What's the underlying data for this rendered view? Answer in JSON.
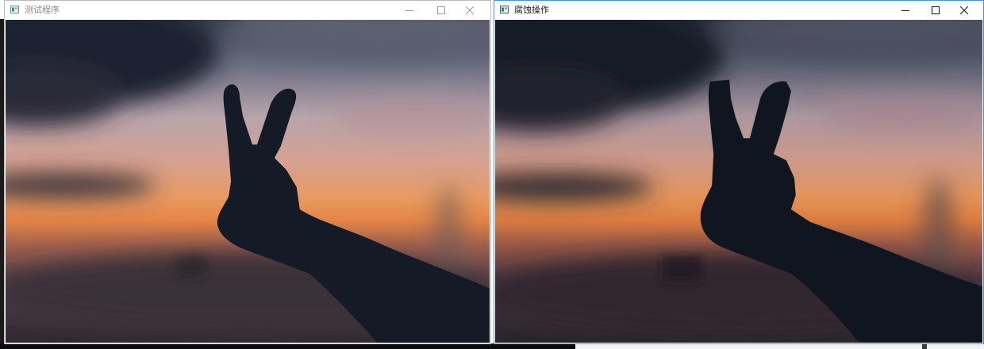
{
  "windows": [
    {
      "title": "测试程序",
      "icon": "app-window-icon",
      "controls": [
        "minimize-icon",
        "maximize-icon",
        "close-icon"
      ],
      "active": false
    },
    {
      "title": "腐蚀操作",
      "icon": "app-window-icon",
      "controls": [
        "minimize-icon",
        "maximize-icon",
        "close-icon"
      ],
      "active": true
    }
  ],
  "colors": {
    "sky_top": "#3b4150",
    "sky_mid": "#b9a0a6",
    "glow": "#e58a4c",
    "water": "#4a3c41",
    "silhouette": "#151b26",
    "active_border": "#4a8fd8"
  }
}
